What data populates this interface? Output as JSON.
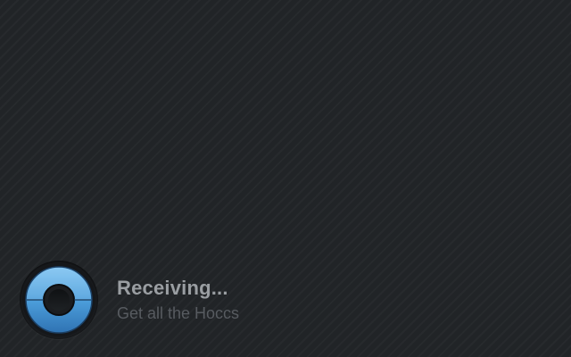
{
  "status": {
    "title": "Receiving...",
    "subtitle": "Get all the Hoccs",
    "icon": "receive-disc-icon"
  },
  "colors": {
    "background": "#212427",
    "accent_blue": "#5aa7e0",
    "accent_blue_dark": "#2d6fae",
    "title_text": "#9a9ea2",
    "subtitle_text": "#575b60"
  }
}
